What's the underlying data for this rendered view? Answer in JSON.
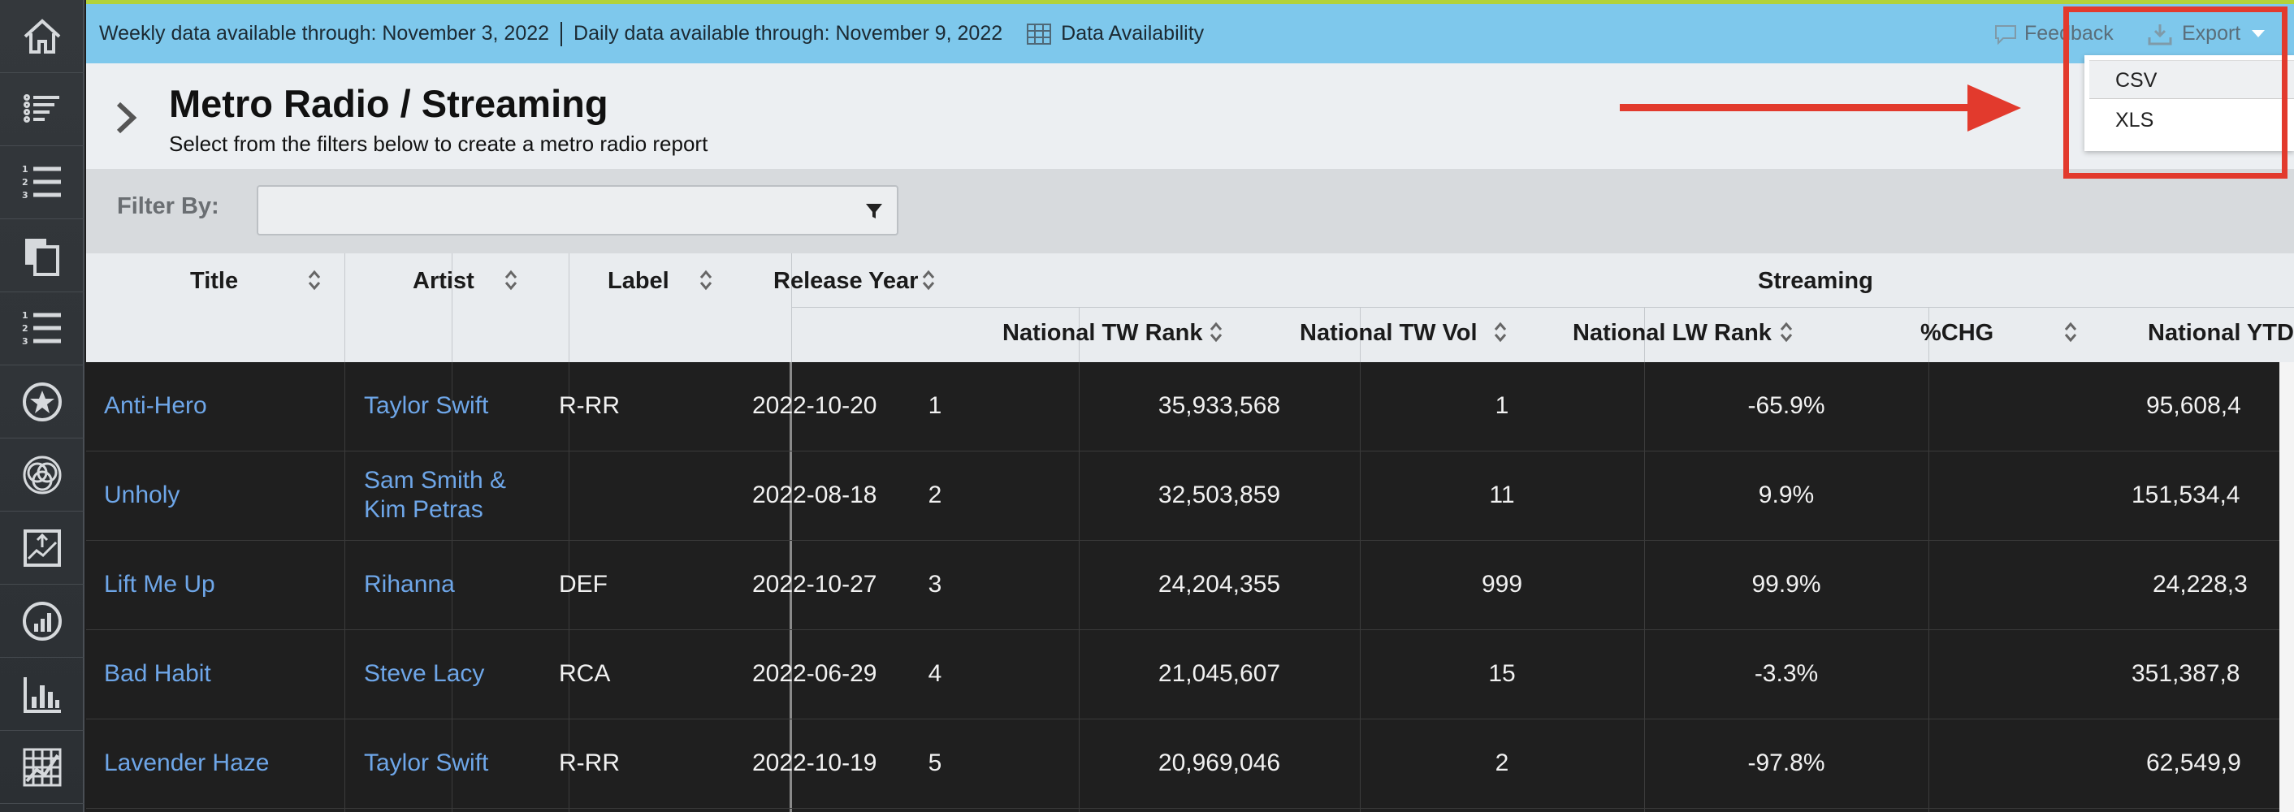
{
  "topbar": {
    "weekly": "Weekly data available through: November 3, 2022",
    "daily": "Daily data available through: November 9, 2022",
    "data_availability": "Data Availability",
    "feedback": "Feedback",
    "export": "Export"
  },
  "export_menu": {
    "items": [
      "CSV",
      "XLS"
    ]
  },
  "header": {
    "title": "Metro Radio / Streaming",
    "subtitle": "Select from the filters below to create a metro radio report"
  },
  "filter": {
    "label": "Filter By:",
    "value": ""
  },
  "table": {
    "group_header": "Streaming",
    "columns": [
      "Title",
      "Artist",
      "Label",
      "Release Year",
      "National TW Rank",
      "National TW Vol",
      "National LW Rank",
      "%CHG",
      "National YTD"
    ],
    "rows": [
      {
        "title": "Anti-Hero",
        "artist": "Taylor Swift",
        "label": "R-RR",
        "year": "2022-10-20",
        "tw_rank": "1",
        "tw_vol": "35,933,568",
        "lw_rank": "1",
        "chg": "-65.9%",
        "ytd": "95,608,4"
      },
      {
        "title": "Unholy",
        "artist": "Sam Smith & Kim Petras",
        "artist_line1": "Sam Smith &",
        "artist_line2": "Kim Petras",
        "label": "",
        "year": "2022-08-18",
        "tw_rank": "2",
        "tw_vol": "32,503,859",
        "lw_rank": "11",
        "chg": "9.9%",
        "ytd": "151,534,4"
      },
      {
        "title": "Lift Me Up",
        "artist": "Rihanna",
        "label": "DEF",
        "year": "2022-10-27",
        "tw_rank": "3",
        "tw_vol": "24,204,355",
        "lw_rank": "999",
        "chg": "99.9%",
        "ytd": "24,228,3"
      },
      {
        "title": "Bad Habit",
        "artist": "Steve Lacy",
        "label": "RCA",
        "year": "2022-06-29",
        "tw_rank": "4",
        "tw_vol": "21,045,607",
        "lw_rank": "15",
        "chg": "-3.3%",
        "ytd": "351,387,8"
      },
      {
        "title": "Lavender Haze",
        "artist": "Taylor Swift",
        "label": "R-RR",
        "year": "2022-10-19",
        "tw_rank": "5",
        "tw_vol": "20,969,046",
        "lw_rank": "2",
        "chg": "-97.8%",
        "ytd": "62,549,9"
      }
    ]
  },
  "sidebar_icons": [
    "home-icon",
    "list-filter-icon",
    "ordered-list-icon",
    "copy-pages-icon",
    "ordered-list-icon",
    "star-icon",
    "venn-icon",
    "chart-upload-icon",
    "gauge-bars-icon",
    "bar-chart-icon",
    "grid-chart-icon"
  ],
  "colors": {
    "topbar": "#7ec8ec",
    "link": "#6ea6e8",
    "highlight": "#e23a2d",
    "body": "#1f1f1f"
  }
}
